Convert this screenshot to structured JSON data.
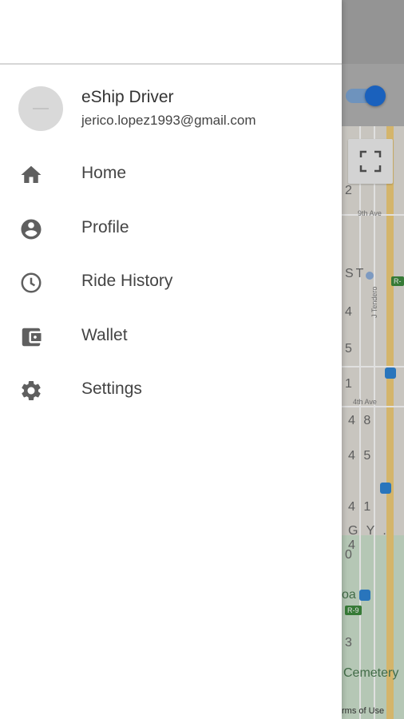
{
  "drawer": {
    "user_name": "eShip Driver",
    "user_email": "jerico.lopez1993@gmail.com",
    "menu": [
      {
        "label": "Home",
        "icon": "home-icon"
      },
      {
        "label": "Profile",
        "icon": "account-circle-icon"
      },
      {
        "label": "Ride History",
        "icon": "clock-icon"
      },
      {
        "label": "Wallet",
        "icon": "wallet-icon"
      },
      {
        "label": "Settings",
        "icon": "gear-icon"
      }
    ]
  },
  "map": {
    "labels": [
      "2",
      "ST",
      "4",
      "5",
      "1",
      "4 8",
      "4 5",
      "4 1",
      "G Y . 4",
      "0",
      "3"
    ],
    "streets": [
      "9th Ave",
      "4th Ave",
      "J Tendero"
    ],
    "route_badges": [
      "R-",
      "R-9"
    ],
    "place_fragments": [
      "oa",
      "Cemetery",
      "rms of Use"
    ]
  },
  "colors": {
    "toggle_on": "#1e6fd8",
    "icon_gray": "#5f5f5f"
  }
}
